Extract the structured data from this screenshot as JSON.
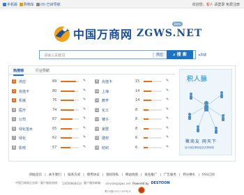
{
  "topbar": {
    "mobile": "手机版",
    "cart": "购物车",
    "history": "(0) 已目导航",
    "greeting_prefix": "欢迎您，",
    "user": "客人",
    "login": "请登录",
    "register": "免费注册"
  },
  "logo": {
    "cn": "中国万商网",
    "en": "ZGWS.NET",
    "beta": "Beta"
  },
  "search": {
    "placeholder": "请输入关键词",
    "category": "供应",
    "button": "搜 索",
    "advanced": "高级"
  },
  "tabs": {
    "active": "热搜榜",
    "second": "行业导航"
  },
  "left_rank": [
    {
      "rank": "1",
      "name": "供应",
      "count": "89",
      "fill": 0.85
    },
    {
      "rank": "2",
      "name": "充值卡",
      "count": "80",
      "fill": 0.78
    },
    {
      "rank": "3",
      "name": "机械",
      "count": "76",
      "fill": 0.74
    },
    {
      "rank": "4",
      "name": "医疗",
      "count": "74",
      "fill": 0.72
    },
    {
      "rank": "5",
      "name": "公司",
      "count": "67",
      "fill": 0.65
    },
    {
      "rank": "6",
      "name": "绿化苗木",
      "count": "65",
      "fill": 0.63
    },
    {
      "rank": "7",
      "name": "绿化",
      "count": "62",
      "fill": 0.6
    },
    {
      "rank": "8",
      "name": "影响",
      "count": "57",
      "fill": 0.55
    }
  ],
  "right_rank": [
    {
      "rank": "9",
      "name": "充值卡",
      "count": "15",
      "fill": 0.45
    },
    {
      "rank": "10",
      "name": "上海",
      "count": "14",
      "fill": 0.42
    },
    {
      "rank": "11",
      "name": "教学",
      "count": "14",
      "fill": 0.42
    },
    {
      "rank": "12",
      "name": "化工",
      "count": "8",
      "fill": 0.28
    },
    {
      "rank": "13",
      "name": "镀子",
      "count": "8",
      "fill": 0.28
    },
    {
      "rank": "14",
      "name": "家居",
      "count": "8",
      "fill": 0.28
    },
    {
      "rank": "15",
      "name": "建材",
      "count": "6",
      "fill": 0.22
    },
    {
      "rank": "16",
      "name": "纺织",
      "count": "6",
      "fill": 0.22
    }
  ],
  "banner": {
    "title": "积人脉",
    "slogan": "聚商友 网天下",
    "sub": "百万商友等你结交共享商机"
  },
  "footer": {
    "links": [
      "网站首页",
      "关于我们",
      "联系方式",
      "使用协议",
      "版权隐私",
      "网站地图",
      "排名推广",
      "广告服务",
      "积分换礼",
      "RSS订阅"
    ],
    "company": "中国万商网企业网 - 客户服务热线：",
    "phone": "13659868434",
    "email_label": "客户服务邮箱：",
    "email": "service@zgws.net",
    "powered": "Powered by",
    "brand": "DESTOON",
    "icp": "黑ICP备12017439号-6"
  },
  "colors": {
    "brand_blue": "#1b4f9c",
    "accent_orange": "#e56d15",
    "button_blue": "#1b73c8"
  }
}
